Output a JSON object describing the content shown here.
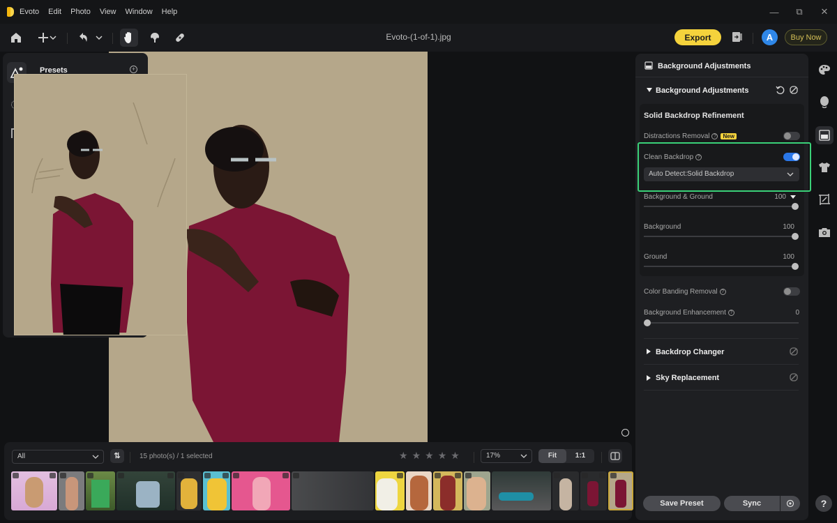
{
  "titlebar": {
    "app_name": "Evoto",
    "menu": [
      "Evoto",
      "Edit",
      "Photo",
      "View",
      "Window",
      "Help"
    ],
    "window_controls": [
      "minimize-icon",
      "restore-icon",
      "close-icon"
    ]
  },
  "toolbar": {
    "icons": [
      "home-icon",
      "add-icon",
      "undo-icon",
      "hand-icon",
      "clone-stamp-icon",
      "bandage-icon"
    ],
    "active_tool": "hand-icon",
    "file_name": "Evoto-(1-of-1).jpg",
    "export_label": "Export",
    "avatar_letter": "A",
    "buy_label": "Buy Now",
    "accent_color": "#f5d33c"
  },
  "left_panel": {
    "presets_label": "Presets",
    "add_icon": "plus-circle-icon"
  },
  "right_panel": {
    "header": "Background Adjustments",
    "section_title": "Background Adjustments",
    "subsection_title": "Solid Backdrop Refinement",
    "distractions_removal": {
      "label": "Distractions Removal",
      "badge": "New",
      "enabled": false
    },
    "clean_backdrop": {
      "label": "Clean Backdrop",
      "enabled": true,
      "mode": "Auto Detect:Solid Backdrop"
    },
    "sliders": [
      {
        "label": "Background & Ground",
        "value": "100",
        "fraction": 1.0
      },
      {
        "label": "Background",
        "value": "100",
        "fraction": 1.0
      },
      {
        "label": "Ground",
        "value": "100",
        "fraction": 1.0
      }
    ],
    "color_banding_removal": {
      "label": "Color Banding Removal",
      "enabled": false
    },
    "background_enhancement": {
      "label": "Background Enhancement",
      "value": "0",
      "fraction": 0.0
    },
    "collapsed_sections": [
      "Backdrop Changer",
      "Sky Replacement"
    ],
    "save_preset_label": "Save Preset",
    "sync_label": "Sync",
    "highlight_color": "#3ad178",
    "toggle_on_color": "#2a77e8"
  },
  "tool_rail": [
    "palette-icon",
    "face-icon",
    "background-icon",
    "clothing-icon",
    "crop-icon",
    "camera-icon"
  ],
  "filmstrip": {
    "filter_value": "All",
    "count_text": "15 photo(s) / 1 selected",
    "rating_stars": 5,
    "zoom_value": "17%",
    "fit_label": "Fit",
    "one_to_one_label": "1:1",
    "thumbnail_count": 15,
    "selected_index": 14
  },
  "help_label": "?"
}
